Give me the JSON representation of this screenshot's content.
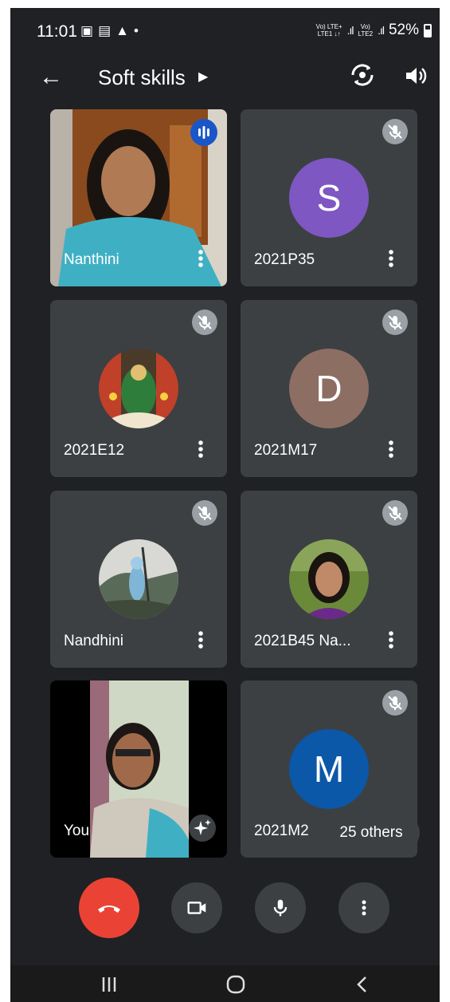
{
  "status_bar": {
    "time": "11:01",
    "net_top": "Vo) LTE+",
    "net_bottom": "LTE1 ↓↑",
    "net2_top": "Vo)",
    "net2_bottom": "LTE2",
    "battery": "52%"
  },
  "header": {
    "title": "Soft skills"
  },
  "participants": [
    {
      "name": "Nanthini",
      "kind": "video",
      "state": "speaking"
    },
    {
      "name": "2021P35",
      "kind": "initial",
      "initial": "S",
      "color": "#7e57c2",
      "state": "muted"
    },
    {
      "name": "2021E12",
      "kind": "photo",
      "state": "muted"
    },
    {
      "name": "2021M17",
      "kind": "initial",
      "initial": "D",
      "color": "#8d6e63",
      "state": "muted"
    },
    {
      "name": "Nandhini",
      "kind": "photo",
      "state": "muted"
    },
    {
      "name": "2021B45 Na...",
      "kind": "photo",
      "state": "muted"
    },
    {
      "name": "You",
      "kind": "video",
      "state": "self"
    },
    {
      "name": "2021M2",
      "kind": "initial",
      "initial": "M",
      "color": "#0b57a8",
      "state": "muted"
    }
  ],
  "others_label": "25 others",
  "colors": {
    "background": "#202124",
    "tile": "#3c4043",
    "end_call": "#ea4335",
    "speaking": "#1a56c8"
  }
}
